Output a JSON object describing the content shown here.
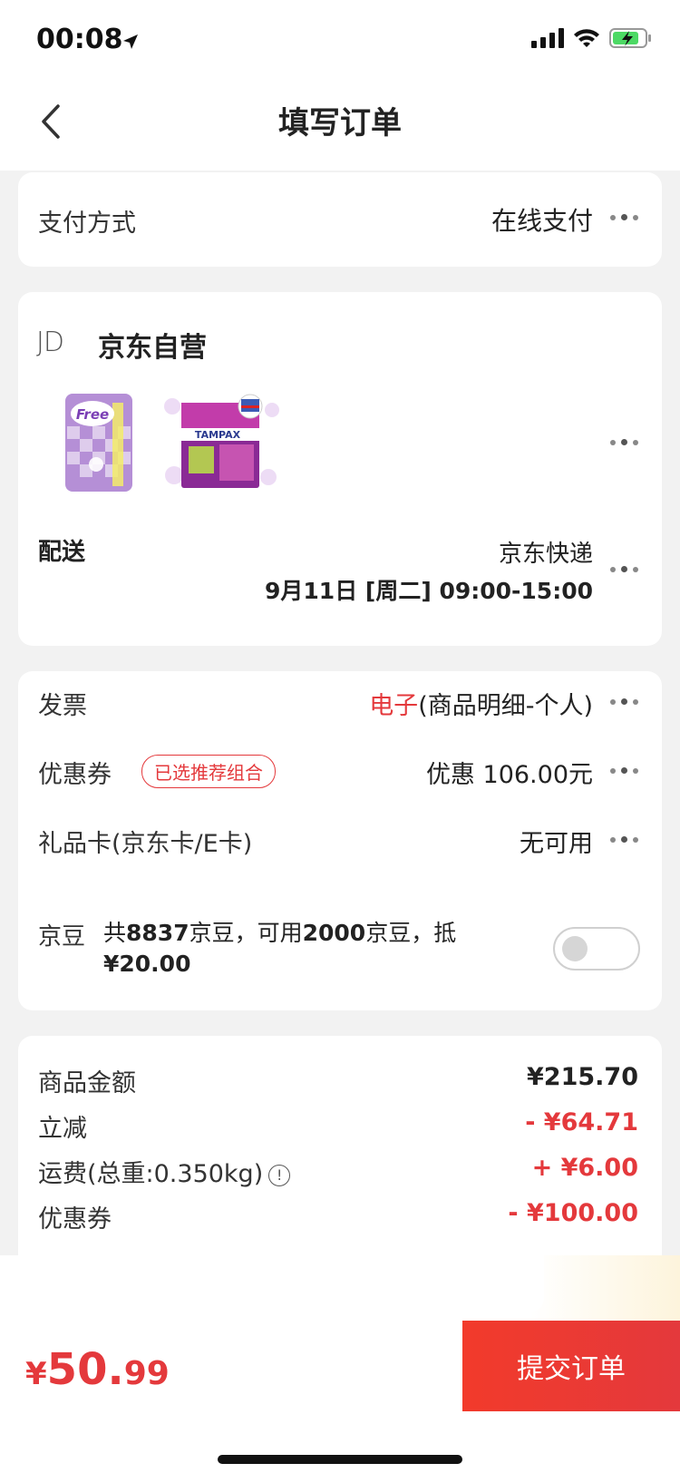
{
  "status_bar": {
    "time": "00:08"
  },
  "nav": {
    "title": "填写订单"
  },
  "payment": {
    "label": "支付方式",
    "value": "在线支付"
  },
  "shop": {
    "logo": "JD",
    "name": "京东自营",
    "products": [
      {
        "brand_text": "Free"
      },
      {
        "brand_text": "TAMPAX"
      }
    ],
    "shipping": {
      "label": "配送",
      "method": "京东快递",
      "time": "9月11日 [周二] 09:00-15:00"
    }
  },
  "options": {
    "invoice": {
      "label": "发票",
      "value_highlight": "电子",
      "value_rest": "(商品明细-个人)"
    },
    "coupon": {
      "label": "优惠券",
      "tag": "已选推荐组合",
      "value": "优惠 106.00元"
    },
    "gift_card": {
      "label": "礼品卡(京东卡/E卡)",
      "value": "无可用"
    },
    "beans": {
      "label": "京豆",
      "text_1": "共",
      "total": "8837",
      "text_2": "京豆，可用",
      "available": "2000",
      "text_3": "京豆，抵",
      "deduct": "¥20.00",
      "enabled": false
    }
  },
  "summary": {
    "rows": [
      {
        "label": "商品金额",
        "amount": "¥215.70",
        "color": "#222222"
      },
      {
        "label": "立减",
        "amount": "- ¥64.71",
        "color": "#e4393c"
      },
      {
        "label": "运费(总重:0.350kg)",
        "amount": "+ ¥6.00",
        "color": "#e4393c"
      },
      {
        "label": "优惠券",
        "amount": "- ¥100.00",
        "color": "#e4393c"
      }
    ]
  },
  "bottom": {
    "currency": "¥",
    "total_int": "50",
    "total_dot": ".",
    "total_dec": "99",
    "submit_label": "提交订单"
  },
  "colors": {
    "accent": "#e4393c",
    "background": "#f2f2f2"
  }
}
